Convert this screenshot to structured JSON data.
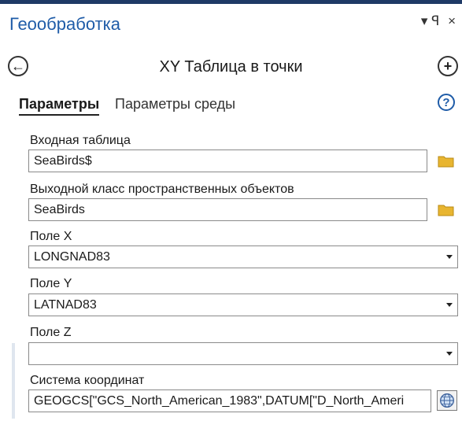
{
  "pane": {
    "title": "Геообработка",
    "pin_glyph": "▾ ꟼ",
    "close_glyph": "×"
  },
  "tool": {
    "title": "XY Таблица в точки",
    "back_icon": "back-arrow-icon",
    "add_icon": "plus-circle-icon"
  },
  "tabs": [
    {
      "label": "Параметры",
      "active": true
    },
    {
      "label": "Параметры среды",
      "active": false
    }
  ],
  "help_label": "?",
  "params": {
    "input_table": {
      "label": "Входная таблица",
      "value": "SeaBirds$"
    },
    "output_fc": {
      "label": "Выходной класс пространственных объектов",
      "value": "SeaBirds"
    },
    "x_field": {
      "label": "Поле X",
      "value": "LONGNAD83"
    },
    "y_field": {
      "label": "Поле Y",
      "value": "LATNAD83"
    },
    "z_field": {
      "label": "Поле Z",
      "value": ""
    },
    "coord_system": {
      "label": "Система координат",
      "value": "GEOGCS[\"GCS_North_American_1983\",DATUM[\"D_North_Ameri"
    }
  },
  "colors": {
    "accent": "#1f5ca8",
    "top_stripe": "#1f3a66",
    "folder": "#e8b530"
  }
}
